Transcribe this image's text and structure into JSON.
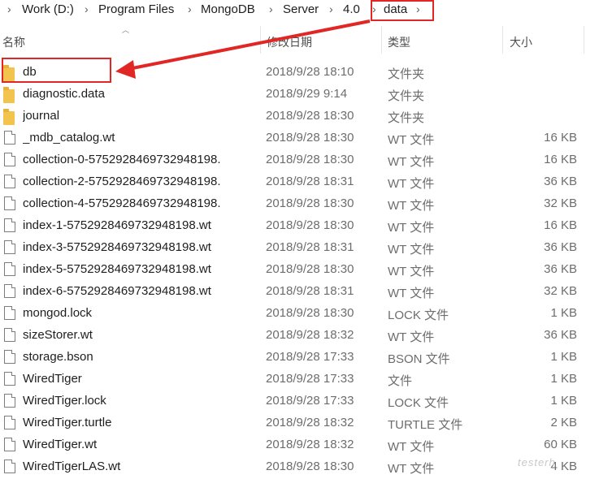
{
  "breadcrumb": {
    "segments": [
      "Work (D:)",
      "Program Files",
      "MongoDB",
      "Server",
      "4.0",
      "data"
    ]
  },
  "columns": {
    "name": "名称",
    "modified": "修改日期",
    "type": "类型",
    "size": "大小"
  },
  "files": [
    {
      "name": "db",
      "date": "2018/9/28 18:10",
      "type": "文件夹",
      "size": "",
      "kind": "folder"
    },
    {
      "name": "diagnostic.data",
      "date": "2018/9/29 9:14",
      "type": "文件夹",
      "size": "",
      "kind": "folder"
    },
    {
      "name": "journal",
      "date": "2018/9/28 18:30",
      "type": "文件夹",
      "size": "",
      "kind": "folder"
    },
    {
      "name": "_mdb_catalog.wt",
      "date": "2018/9/28 18:30",
      "type": "WT 文件",
      "size": "16 KB",
      "kind": "file"
    },
    {
      "name": "collection-0-5752928469732948198.",
      "date": "2018/9/28 18:30",
      "type": "WT 文件",
      "size": "16 KB",
      "kind": "file"
    },
    {
      "name": "collection-2-5752928469732948198.",
      "date": "2018/9/28 18:31",
      "type": "WT 文件",
      "size": "36 KB",
      "kind": "file"
    },
    {
      "name": "collection-4-5752928469732948198.",
      "date": "2018/9/28 18:30",
      "type": "WT 文件",
      "size": "32 KB",
      "kind": "file"
    },
    {
      "name": "index-1-5752928469732948198.wt",
      "date": "2018/9/28 18:30",
      "type": "WT 文件",
      "size": "16 KB",
      "kind": "file"
    },
    {
      "name": "index-3-5752928469732948198.wt",
      "date": "2018/9/28 18:31",
      "type": "WT 文件",
      "size": "36 KB",
      "kind": "file"
    },
    {
      "name": "index-5-5752928469732948198.wt",
      "date": "2018/9/28 18:30",
      "type": "WT 文件",
      "size": "36 KB",
      "kind": "file"
    },
    {
      "name": "index-6-5752928469732948198.wt",
      "date": "2018/9/28 18:31",
      "type": "WT 文件",
      "size": "32 KB",
      "kind": "file"
    },
    {
      "name": "mongod.lock",
      "date": "2018/9/28 18:30",
      "type": "LOCK 文件",
      "size": "1 KB",
      "kind": "file"
    },
    {
      "name": "sizeStorer.wt",
      "date": "2018/9/28 18:32",
      "type": "WT 文件",
      "size": "36 KB",
      "kind": "file"
    },
    {
      "name": "storage.bson",
      "date": "2018/9/28 17:33",
      "type": "BSON 文件",
      "size": "1 KB",
      "kind": "file"
    },
    {
      "name": "WiredTiger",
      "date": "2018/9/28 17:33",
      "type": "文件",
      "size": "1 KB",
      "kind": "file"
    },
    {
      "name": "WiredTiger.lock",
      "date": "2018/9/28 17:33",
      "type": "LOCK 文件",
      "size": "1 KB",
      "kind": "file"
    },
    {
      "name": "WiredTiger.turtle",
      "date": "2018/9/28 18:32",
      "type": "TURTLE 文件",
      "size": "2 KB",
      "kind": "file"
    },
    {
      "name": "WiredTiger.wt",
      "date": "2018/9/28 18:32",
      "type": "WT 文件",
      "size": "60 KB",
      "kind": "file"
    },
    {
      "name": "WiredTigerLAS.wt",
      "date": "2018/9/28 18:30",
      "type": "WT 文件",
      "size": "4 KB",
      "kind": "file"
    }
  ],
  "watermark": "testerh",
  "colors": {
    "annotation": "#e12626",
    "folder": "#f2c44e"
  }
}
